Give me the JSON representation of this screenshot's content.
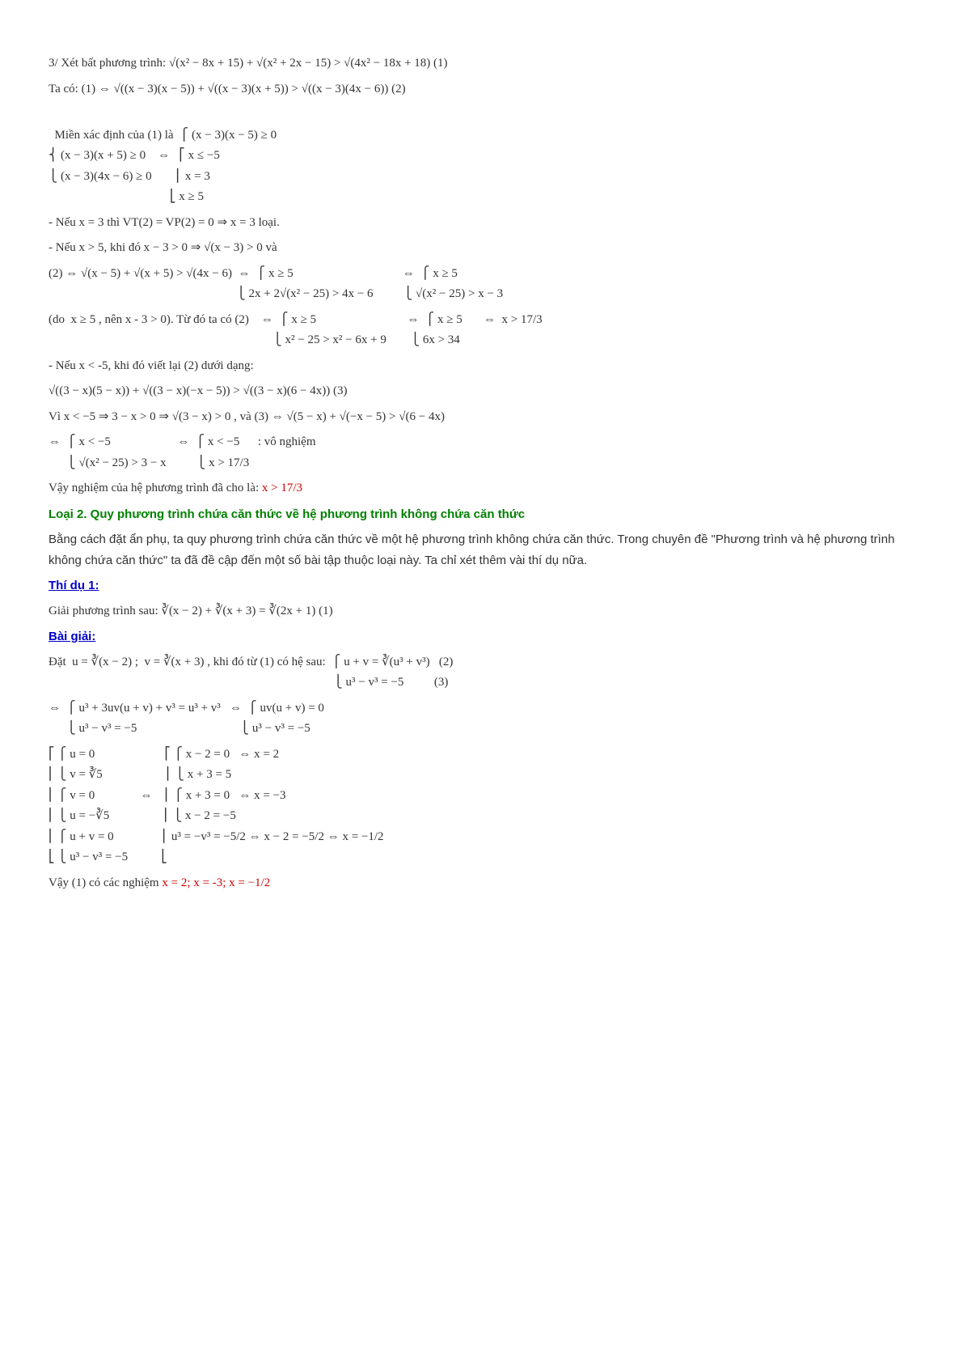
{
  "p1": "3/ Xét bất phương trình:  √(x² − 8x + 15) + √(x² + 2x − 15) > √(4x² − 18x + 18)   (1)",
  "p2": "Ta có:  (1) ⇔ √((x − 3)(x − 5)) + √((x − 3)(x + 5)) > √((x − 3)(4x − 6))   (2)",
  "p3a": "Miền xác định của (1) là  ",
  "p3b": "⎧ (x − 3)(x − 5) ≥ 0\n⎨ (x − 3)(x + 5) ≥ 0    ⇔   ⎡ x ≤ −5\n⎩ (x − 3)(4x − 6) ≥ 0        ⎢ x = 3\n                                        ⎣ x ≥ 5",
  "p4": "- Nếu x = 3 thì  VT(2) = VP(2) = 0 ⇒ x = 3  loại.",
  "p5": "- Nếu x > 5, khi đó  x − 3 > 0 ⇒ √(x − 3) > 0  và",
  "p6": "(2) ⇔ √(x − 5) + √(x + 5) > √(4x − 6)  ⇔  ⎧ x ≥ 5                                    ⇔  ⎧ x ≥ 5\n                                                              ⎩ 2x + 2√(x² − 25) > 4x − 6          ⎩ √(x² − 25) > x − 3",
  "p7": "(do  x ≥ 5 , nên x - 3 > 0). Từ đó ta có (2)    ⇔  ⎧ x ≥ 5                              ⇔  ⎧ x ≥ 5       ⇔  x > 17/3\n                                                                          ⎩ x² − 25 > x² − 6x + 9        ⎩ 6x > 34",
  "p8": "- Nếu x < -5, khi đó viết lại (2) dưới dạng:",
  "p9": "√((3 − x)(5 − x)) + √((3 − x)(−x − 5)) > √((3 − x)(6 − 4x))   (3)",
  "p10": "Vì  x < −5 ⇒ 3 − x > 0 ⇒ √(3 − x) > 0 , và (3) ⇔ √(5 − x) + √(−x − 5) > √(6 − 4x)",
  "p11": "⇔  ⎧ x < −5                      ⇔  ⎧ x < −5      : vô nghiệm\n      ⎩ √(x² − 25) > 3 − x          ⎩ x > 17/3",
  "p12a": "Vậy nghiệm của hệ phương trình đã cho là:   ",
  "p12b": "x > 17/3",
  "h1": "Loại 2. Quy phương trình chứa căn thức về hệ phương trình không chứa căn thức",
  "p13": "Bằng cách đặt ẩn phụ, ta quy phương trình chứa căn thức về một hệ phương trình không chứa căn thức. Trong chuyên đề \"Phương trình và hệ phương trình không chứa căn thức\" ta đã đề cập đến một số bài tập thuộc loại này. Ta chỉ xét thêm vài thí dụ nữa.",
  "h2": "Thí dụ 1:",
  "p14": "Giải phương trình sau:  ∛(x − 2) + ∛(x + 3) = ∛(2x + 1)   (1)",
  "h3": "Bài giải:",
  "p15": "Đặt  u = ∛(x − 2) ;  v = ∛(x + 3) , khi đó từ (1) có hệ sau:  ⎧ u + v = ∛(u³ + v³)   (2)\n                                                                                              ⎩ u³ − v³ = −5          (3)",
  "p16": "⇔  ⎧ u³ + 3uv(u + v) + v³ = u³ + v³   ⇔  ⎧ uv(u + v) = 0\n      ⎩ u³ − v³ = −5                                  ⎩ u³ − v³ = −5",
  "p17": "⎡ ⎧ u = 0                       ⎡ ⎧ x − 2 = 0   ⇔ x = 2\n⎢ ⎩ v = ∛5                     ⎢ ⎩ x + 3 = 5\n⎢ ⎧ v = 0               ⇔    ⎢ ⎧ x + 3 = 0   ⇔ x = −3\n⎢ ⎩ u = −∛5                  ⎢ ⎩ x − 2 = −5\n⎢ ⎧ u + v = 0                ⎢ u³ = −v³ = −5/2 ⇔ x − 2 = −5/2 ⇔ x = −1/2\n⎣ ⎩ u³ − v³ = −5           ⎣",
  "p18a": "Vậy (1) có các nghiệm ",
  "p18b": "x = 2;  x = -3;  x = −1/2"
}
